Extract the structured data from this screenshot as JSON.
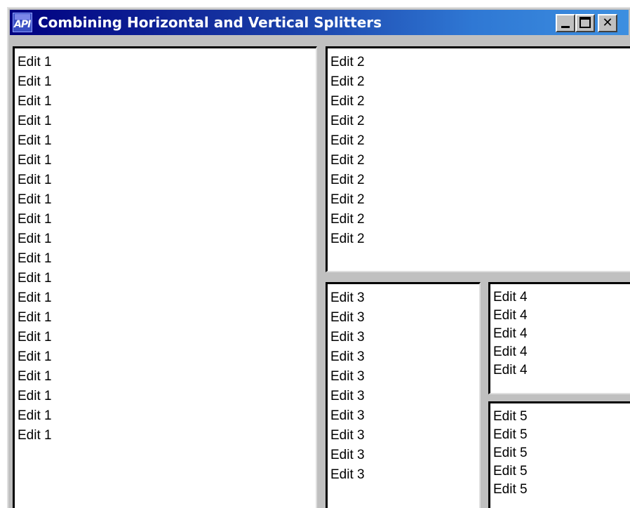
{
  "window": {
    "title": "Combining Horizontal and Vertical Splitters",
    "icon": "api-app-icon",
    "caption_buttons": {
      "minimize": "minimize-icon",
      "maximize": "maximize-icon",
      "close": "close-icon"
    }
  },
  "panes": {
    "edit1": [
      "Edit 1",
      "Edit 1",
      "Edit 1",
      "Edit 1",
      "Edit 1",
      "Edit 1",
      "Edit 1",
      "Edit 1",
      "Edit 1",
      "Edit 1",
      "Edit 1",
      "Edit 1",
      "Edit 1",
      "Edit 1",
      "Edit 1",
      "Edit 1",
      "Edit 1",
      "Edit 1",
      "Edit 1",
      "Edit 1"
    ],
    "edit2": [
      "Edit 2",
      "Edit 2",
      "Edit 2",
      "Edit 2",
      "Edit 2",
      "Edit 2",
      "Edit 2",
      "Edit 2",
      "Edit 2",
      "Edit 2"
    ],
    "edit3": [
      "Edit 3",
      "Edit 3",
      "Edit 3",
      "Edit 3",
      "Edit 3",
      "Edit 3",
      "Edit 3",
      "Edit 3",
      "Edit 3",
      "Edit 3"
    ],
    "edit4": [
      "Edit 4",
      "Edit 4",
      "Edit 4",
      "Edit 4",
      "Edit 4"
    ],
    "edit5": [
      "Edit 5",
      "Edit 5",
      "Edit 5",
      "Edit 5",
      "Edit 5"
    ]
  }
}
